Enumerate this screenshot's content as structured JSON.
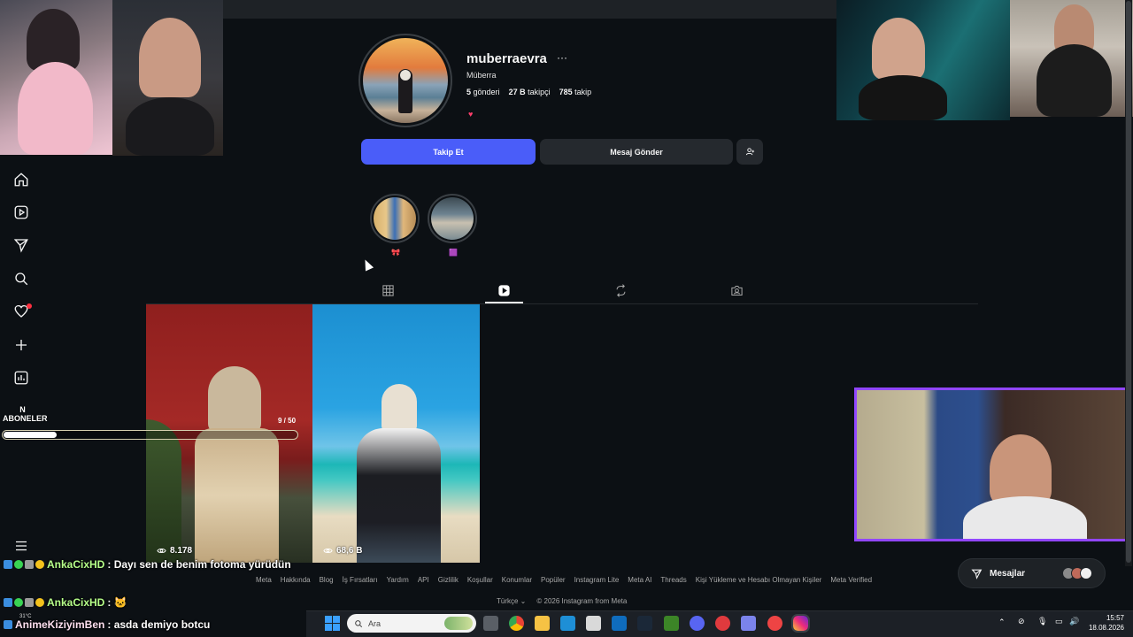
{
  "profile": {
    "username": "muberraevra",
    "more_label": "···",
    "full_name": "Müberra",
    "stats": {
      "posts_value": "5",
      "posts_label": "gönderi",
      "followers_value": "27 B",
      "followers_label": "takipçi",
      "following_value": "785",
      "following_label": "takip"
    },
    "bio_icon": "heart"
  },
  "actions": {
    "follow_label": "Takip Et",
    "message_label": "Mesaj Gönder",
    "suggest_icon": "add-person-icon"
  },
  "highlights": [
    {
      "label": "🎀"
    },
    {
      "label": "🟪"
    }
  ],
  "tabs": [
    {
      "icon": "grid-icon",
      "active": false
    },
    {
      "icon": "reels-icon",
      "active": true
    },
    {
      "icon": "repost-icon",
      "active": false
    },
    {
      "icon": "tagged-icon",
      "active": false
    }
  ],
  "posts": [
    {
      "views": "8.178"
    },
    {
      "views": "68,6 B"
    }
  ],
  "footer": {
    "links": [
      "Meta",
      "Hakkında",
      "Blog",
      "İş Fırsatları",
      "Yardım",
      "API",
      "Gizlilik",
      "Koşullar",
      "Konumlar",
      "Popüler",
      "Instagram Lite",
      "Meta AI",
      "Threads",
      "Kişi Yükleme ve Hesabı Olmayan Kişiler",
      "Meta Verified"
    ],
    "language": "Türkçe ⌄",
    "copyright": "© 2026 Instagram from Meta"
  },
  "messages_pill": {
    "label": "Mesajlar"
  },
  "overlay": {
    "sub_label": "N\nABONELER",
    "sub_count": "9 / 50",
    "sub_progress": 0.18,
    "chat": [
      {
        "user": "AnkaCixHD",
        "text": ": Dayı sen de benim fotoma yürüdün"
      },
      {
        "user": "AnkaCixHD",
        "text": ": 🐱"
      },
      {
        "user": "AnimeKiziyimBen",
        "text": ": asda demiyo botcu"
      }
    ]
  },
  "taskbar": {
    "search_placeholder": "Ara",
    "time": "15:57",
    "date": "18.08.2026",
    "weather": "31°C"
  },
  "colors": {
    "background": "#0c1014",
    "follow_button": "#4a5df9",
    "secondary_button": "#25292e",
    "twitch_purple": "#9146ff"
  }
}
